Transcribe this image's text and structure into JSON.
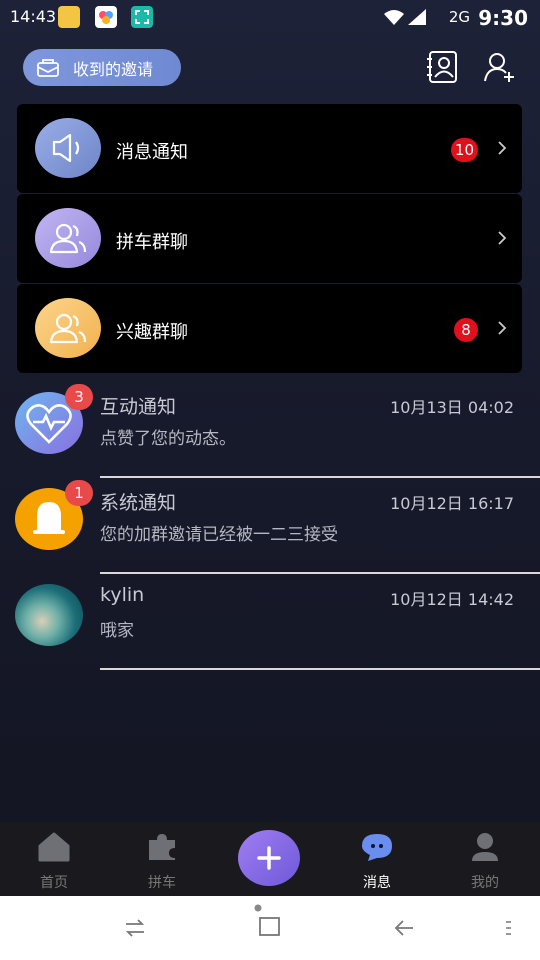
{
  "status_bar": {
    "left_time": "14:43",
    "network": "2G",
    "right_time": "9:30"
  },
  "header": {
    "invite_label": "收到的邀请"
  },
  "groups": [
    {
      "label": "消息通知",
      "badge": "10",
      "color": "#7e93d4"
    },
    {
      "label": "拼车群聊",
      "badge": "",
      "color": "#a99be6"
    },
    {
      "label": "兴趣群聊",
      "badge": "8",
      "color": "#f6c36a"
    }
  ],
  "conversations": [
    {
      "name": "互动通知",
      "time": "10月13日 04:02",
      "message": "点赞了您的动态。",
      "badge": "3"
    },
    {
      "name": "系统通知",
      "time": "10月12日 16:17",
      "message": "您的加群邀请已经被一二三接受",
      "badge": "1"
    },
    {
      "name": "kylin",
      "time": "10月12日 14:42",
      "message": "哦家",
      "badge": ""
    }
  ],
  "nav": {
    "home": "首页",
    "carpool": "拼车",
    "messages": "消息",
    "mine": "我的"
  },
  "colors": {
    "accent": "#7a63e0",
    "badge": "#e0101c"
  }
}
